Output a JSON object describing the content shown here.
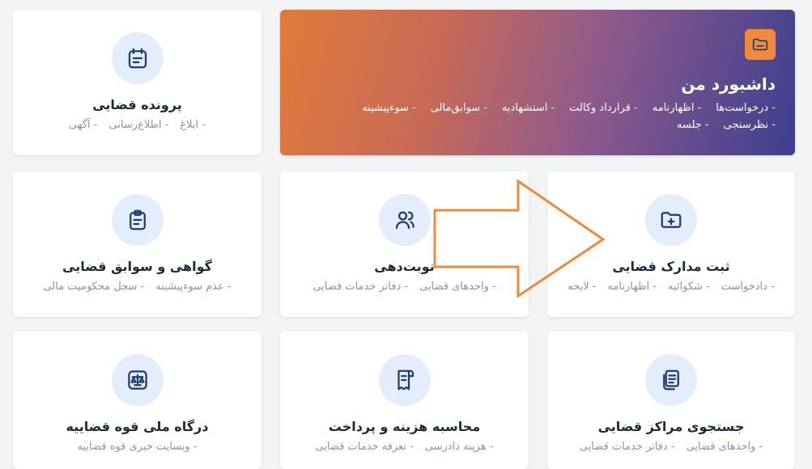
{
  "banner": {
    "title": "داشبورد من",
    "links": [
      "درخواست‌ها",
      "اظهارنامه",
      "قرارداد وکالت",
      "استشهادیه",
      "سوابق‌مالی",
      "سوءپیشینه",
      "نظرسنجی",
      "جلسه"
    ]
  },
  "cards": {
    "case_file": {
      "title": "پرونده قضایی",
      "links": [
        "ابلاغ",
        "اطلاع‌رسانی",
        "آگهی"
      ]
    },
    "submit_docs": {
      "title": "ثبت مدارک قضایی",
      "links": [
        "دادخواست",
        "شکوائیه",
        "اظهارنامه",
        "لایحه"
      ]
    },
    "appointment": {
      "title": "نوبت‌دهی",
      "links": [
        "واحدهای قضایی",
        "دفاتر خدمات قضایی"
      ]
    },
    "certificate": {
      "title": "گواهی و سوابق قضایی",
      "links": [
        "عدم سوءپیشینه",
        "سجل محکومیت مالی"
      ]
    },
    "search_centers": {
      "title": "جستجوی مراکز قضایی",
      "links": [
        "واحدهای قضایی",
        "دفاتر خدمات قضایی"
      ]
    },
    "cost_payment": {
      "title": "محاسبه هزینه و پرداخت",
      "links": [
        "هزینه دادرسی",
        "تعرفه خدمات قضایی"
      ]
    },
    "national_portal": {
      "title": "درگاه ملی قوه قضاییه",
      "links": [
        "وبسایت خبری قوه قضاییه"
      ]
    }
  },
  "colors": {
    "accent": "#1e3a6e",
    "icon_bg": "#e3edfb",
    "banner_icon": "#f08a3c",
    "arrow": "#ef8a3a"
  }
}
